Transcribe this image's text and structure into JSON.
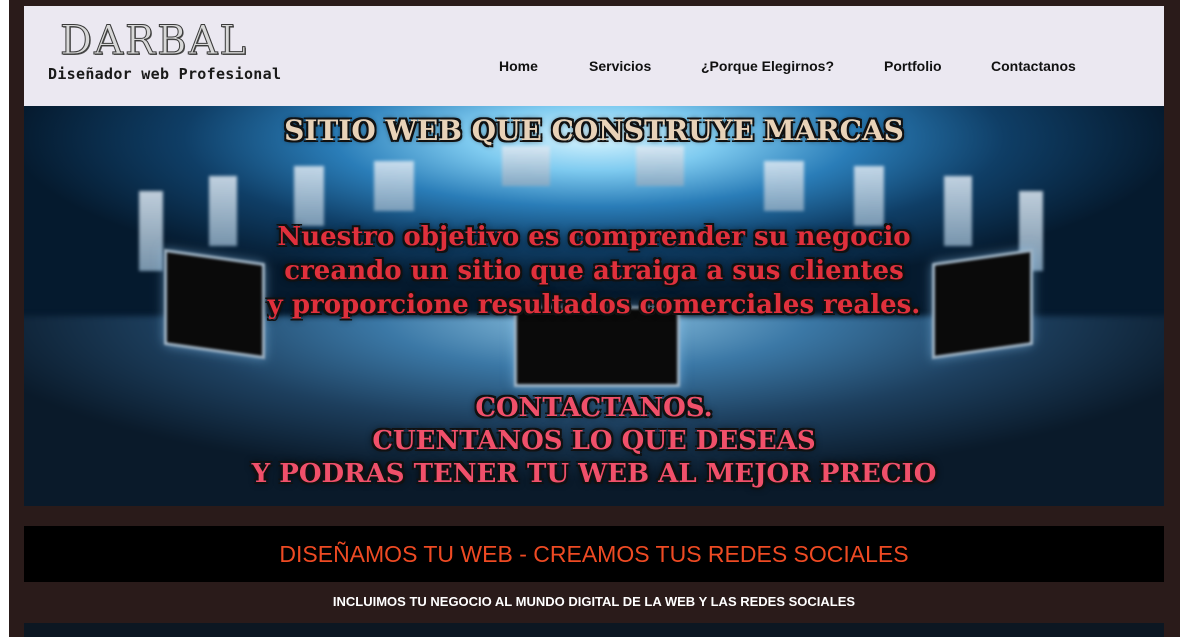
{
  "logo": {
    "title": "DARBAL",
    "subtitle": "Diseñador web Profesional"
  },
  "nav": {
    "items": [
      {
        "label": "Home"
      },
      {
        "label": "Servicios"
      },
      {
        "label": "¿Porque Elegirnos?"
      },
      {
        "label": "Portfolio"
      },
      {
        "label": "Contactanos"
      }
    ]
  },
  "hero": {
    "headline": "SITIO WEB QUE CONSTRUYE MARCAS",
    "objective_lines": [
      "Nuestro objetivo es comprender su negocio",
      "creando un sitio que atraiga a sus clientes",
      "y proporcione resultados comerciales reales."
    ],
    "cta_lines": [
      "CONTACTANOS.",
      "CUENTANOS LO QUE DESEAS",
      "Y PODRAS TENER TU WEB AL MEJOR PRECIO"
    ]
  },
  "banner": {
    "text": "DISEÑAMOS TU WEB - CREAMOS TUS REDES SOCIALES"
  },
  "subline": {
    "text": "INCLUIMOS TU NEGOCIO AL MUNDO DIGITAL DE LA WEB Y LAS REDES SOCIALES"
  },
  "colors": {
    "frame": "#2a1b1a",
    "header_bg": "#ebe8f1",
    "banner_text": "#ee4a23",
    "hero_red": "#e0303c"
  }
}
